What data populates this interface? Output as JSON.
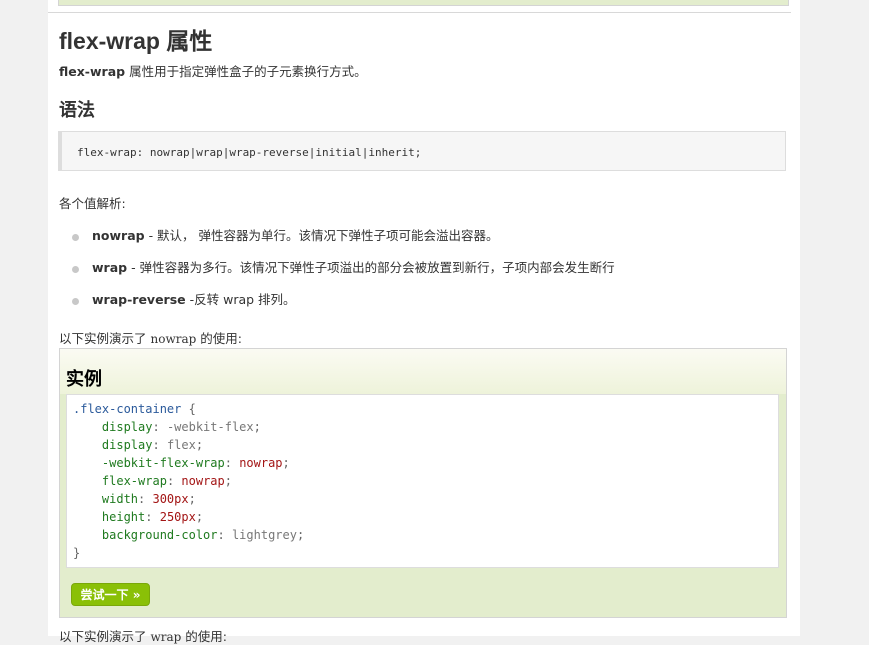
{
  "page": {
    "title": "flex-wrap 属性",
    "intro_code": "flex-wrap",
    "intro_text": " 属性用于指定弹性盒子的子元素换行方式。",
    "syntax_heading": "语法",
    "syntax_code": "flex-wrap: nowrap|wrap|wrap-reverse|initial|inherit;",
    "values_title": "各个值解析:",
    "values": [
      {
        "term": "nowrap",
        "desc": " - 默认， 弹性容器为单行。该情况下弹性子项可能会溢出容器。"
      },
      {
        "term": "wrap",
        "desc": " - 弹性容器为多行。该情况下弹性子项溢出的部分会被放置到新行，子项内部会发生断行"
      },
      {
        "term": "wrap-reverse",
        "desc": " -反转 wrap 排列。"
      }
    ],
    "demo_note_pre": "以下实例演示了 ",
    "demo_note_code": "nowrap",
    "demo_note_post": " 的使用:",
    "example": {
      "heading": "实例",
      "code_lines": [
        [
          {
            "t": ".flex-container",
            "c": "sel"
          },
          {
            "t": " {",
            "c": "punct"
          }
        ],
        [
          {
            "t": "    ",
            "c": ""
          },
          {
            "t": "display",
            "c": "prop"
          },
          {
            "t": ": ",
            "c": "punct"
          },
          {
            "t": "-webkit-flex",
            "c": "val"
          },
          {
            "t": ";",
            "c": "punct"
          }
        ],
        [
          {
            "t": "    ",
            "c": ""
          },
          {
            "t": "display",
            "c": "prop"
          },
          {
            "t": ": ",
            "c": "punct"
          },
          {
            "t": "flex",
            "c": "val"
          },
          {
            "t": ";",
            "c": "punct"
          }
        ],
        [
          {
            "t": "    ",
            "c": ""
          },
          {
            "t": "-webkit-flex-wrap",
            "c": "prop"
          },
          {
            "t": ": ",
            "c": "punct"
          },
          {
            "t": "nowrap",
            "c": "kw"
          },
          {
            "t": ";",
            "c": "punct"
          }
        ],
        [
          {
            "t": "    ",
            "c": ""
          },
          {
            "t": "flex-wrap",
            "c": "prop"
          },
          {
            "t": ": ",
            "c": "punct"
          },
          {
            "t": "nowrap",
            "c": "kw"
          },
          {
            "t": ";",
            "c": "punct"
          }
        ],
        [
          {
            "t": "    ",
            "c": ""
          },
          {
            "t": "width",
            "c": "prop"
          },
          {
            "t": ": ",
            "c": "punct"
          },
          {
            "t": "300px",
            "c": "num"
          },
          {
            "t": ";",
            "c": "punct"
          }
        ],
        [
          {
            "t": "    ",
            "c": ""
          },
          {
            "t": "height",
            "c": "prop"
          },
          {
            "t": ": ",
            "c": "punct"
          },
          {
            "t": "250px",
            "c": "num"
          },
          {
            "t": ";",
            "c": "punct"
          }
        ],
        [
          {
            "t": "    ",
            "c": ""
          },
          {
            "t": "background-color",
            "c": "prop"
          },
          {
            "t": ": ",
            "c": "punct"
          },
          {
            "t": "lightgrey",
            "c": "val"
          },
          {
            "t": ";",
            "c": "punct"
          }
        ],
        [
          {
            "t": "}",
            "c": "punct"
          }
        ]
      ],
      "try_button_label": "尝试一下 »"
    },
    "bottom_note_pre": "以下实例演示了 ",
    "bottom_note_code": "wrap",
    "bottom_note_post": " 的使用:"
  },
  "colors": {
    "accent_button": "#8ac007",
    "example_bg": "#e3edcd"
  }
}
